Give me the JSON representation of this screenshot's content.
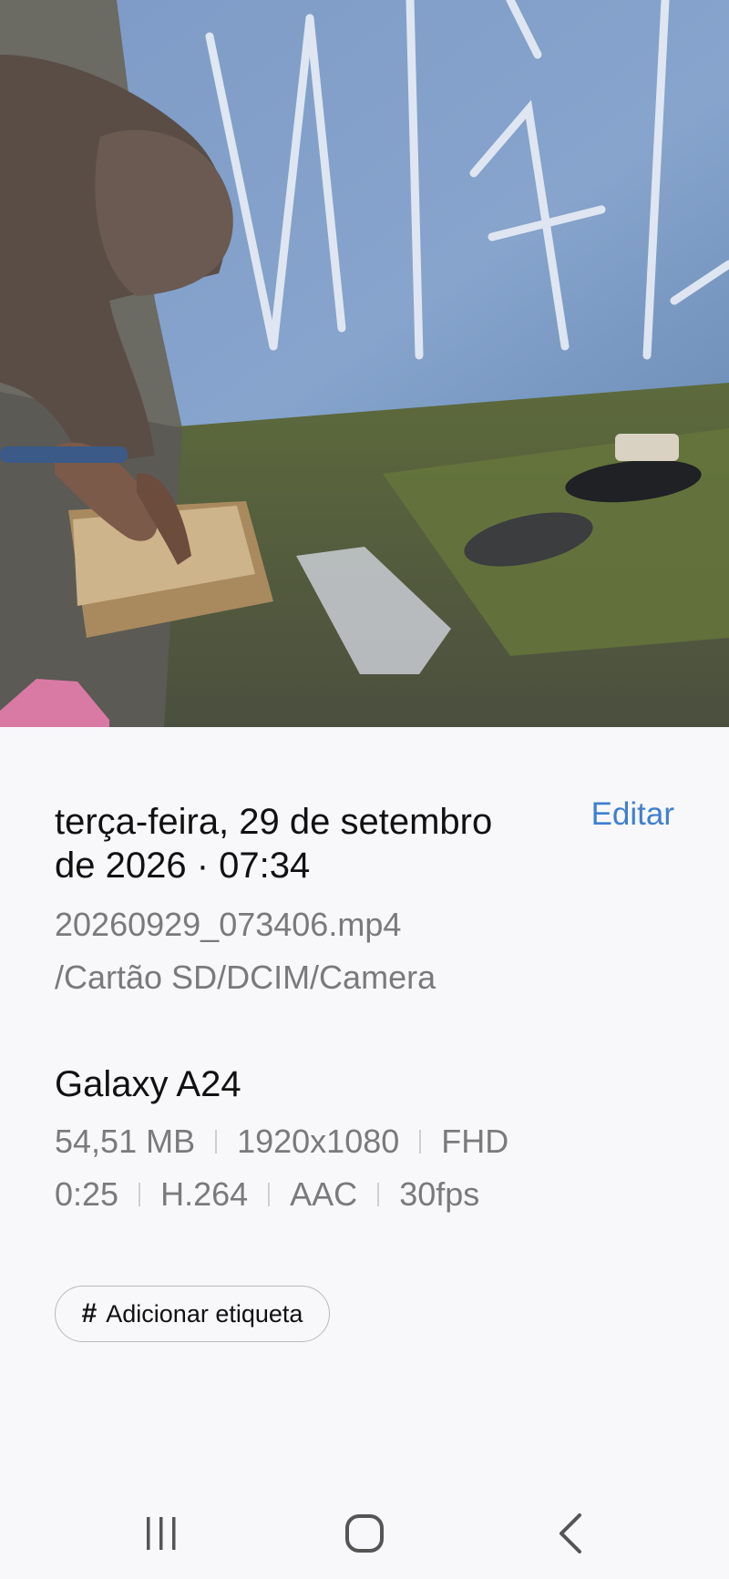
{
  "details": {
    "date_time": "terça-feira, 29 de setembro de 2026 · 07:34",
    "edit_label": "Editar",
    "file_name": "20260929_073406.mp4",
    "file_path": "/Cartão SD/DCIM/Camera",
    "device": "Galaxy A24",
    "size": "54,51 MB",
    "resolution": "1920x1080",
    "quality": "FHD",
    "duration": "0:25",
    "video_codec": "H.264",
    "audio_codec": "AAC",
    "framerate": "30fps",
    "add_tag_label": "Adicionar etiqueta",
    "tag_icon": "#"
  },
  "navbar": {
    "recents_icon": "recents-icon",
    "home_icon": "home-icon",
    "back_icon": "back-icon"
  },
  "colors": {
    "accent": "#3f7fcf",
    "background": "#f8f8fb",
    "secondary_text": "#7a7a7a"
  }
}
